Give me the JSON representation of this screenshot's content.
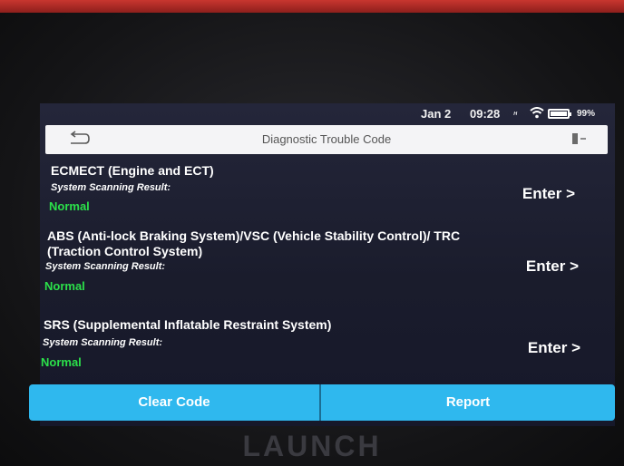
{
  "statusbar": {
    "date": "Jan 2",
    "time": "09:28",
    "network": "ᴴ",
    "battery": "99%"
  },
  "titlebar": {
    "title": "Diagnostic Trouble Code",
    "back_icon": "back-arrow-icon",
    "exit_icon": "exit-icon"
  },
  "systems": [
    {
      "name": "ECMECT (Engine and ECT)",
      "result_label": "System Scanning Result:",
      "status": "Normal",
      "action": "Enter >"
    },
    {
      "name": "ABS (Anti-lock Braking System)/VSC (Vehicle Stability Control)/ TRC (Traction Control System)",
      "result_label": "System Scanning Result:",
      "status": "Normal",
      "action": "Enter >"
    },
    {
      "name": "SRS (Supplemental Inflatable Restraint System)",
      "result_label": "System Scanning Result:",
      "status": "Normal",
      "action": "Enter >"
    }
  ],
  "actions": {
    "clear_code": "Clear Code",
    "report": "Report"
  },
  "device": {
    "brand": "LAUNCH"
  },
  "colors": {
    "accent": "#2fb8ee",
    "status_normal": "#2be04a"
  }
}
